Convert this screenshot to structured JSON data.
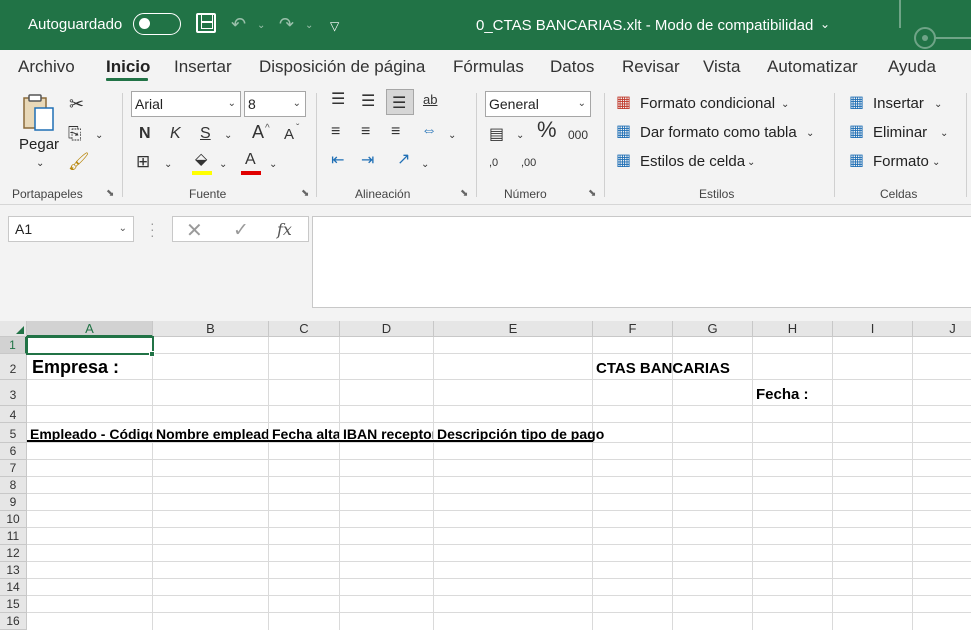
{
  "titlebar": {
    "autosave_label": "Autoguardado",
    "file_title": "0_CTAS BANCARIAS.xlt  -  Modo de compatibilidad",
    "accent_color": "#217346"
  },
  "tabs": [
    "Archivo",
    "Inicio",
    "Insertar",
    "Disposición de página",
    "Fórmulas",
    "Datos",
    "Revisar",
    "Vista",
    "Automatizar",
    "Ayuda"
  ],
  "active_tab": "Inicio",
  "ribbon": {
    "clipboard": {
      "paste_label": "Pegar",
      "group_label": "Portapapeles"
    },
    "font": {
      "font_name": "Arial",
      "font_size": "8",
      "bold": "N",
      "italic": "K",
      "underline": "S",
      "grow": "A",
      "shrink": "A",
      "color_letter": "A",
      "group_label": "Fuente"
    },
    "alignment": {
      "group_label": "Alineación"
    },
    "number": {
      "format": "General",
      "percent": "%",
      "thousands": "000",
      "inc_decimals": ",0",
      "dec_decimals": ",00",
      "group_label": "Número"
    },
    "styles": {
      "conditional": "Formato condicional",
      "as_table": "Dar formato como tabla",
      "cell_styles": "Estilos de celda",
      "group_label": "Estilos"
    },
    "cells": {
      "insert": "Insertar",
      "delete": "Eliminar",
      "format": "Formato",
      "group_label": "Celdas"
    }
  },
  "formula_bar": {
    "name_box": "A1",
    "fx": "fx",
    "content": ""
  },
  "grid": {
    "columns": [
      "A",
      "B",
      "C",
      "D",
      "E",
      "F",
      "G",
      "H",
      "I",
      "J"
    ],
    "rows": [
      "1",
      "2",
      "3",
      "4",
      "5",
      "6",
      "7",
      "8",
      "9",
      "10",
      "11",
      "12",
      "13",
      "14",
      "15",
      "16"
    ],
    "selected_cell": "A1",
    "cells": {
      "A2": "Empresa :",
      "F2": "CTAS BANCARIAS",
      "H3": "Fecha :",
      "A5": "Empleado -  Código",
      "B5": "Nombre empleado",
      "C5": "Fecha alta",
      "D5": "IBAN receptor",
      "E5": "Descripción tipo de pago"
    }
  }
}
